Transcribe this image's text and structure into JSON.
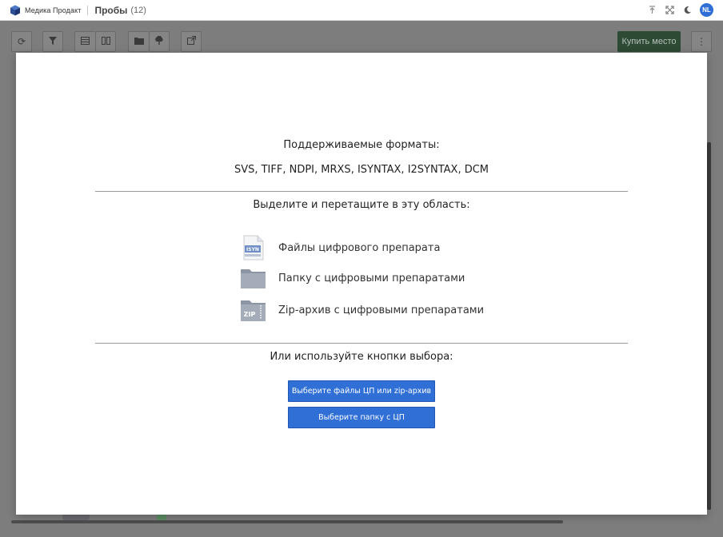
{
  "app": {
    "brand": "Медика Продакт",
    "page_title": "Пробы",
    "page_count": "(12)",
    "user_initials": "NL",
    "icons": [
      "upload-top-icon",
      "fullscreen-icon",
      "moon-icon"
    ]
  },
  "toolbar": {
    "icons": [
      "refresh-icon",
      "filter-icon",
      "table-view-icon",
      "split-view-icon",
      "folder-icon",
      "cloud-upload-icon",
      "open-external-icon"
    ],
    "buy_label": "Купить место",
    "more_icon": "more-vertical-icon"
  },
  "modal": {
    "supported_title": "Поддерживаемые форматы:",
    "formats": "SVS, TIFF, NDPI, MRXS, ISYNTAX, I2SYNTAX, DCM",
    "drag_title": "Выделите и перетащите в эту область:",
    "items": [
      {
        "icon": "isyn-file-icon",
        "icon_text": "ISYN",
        "label": "Файлы цифрового препарата"
      },
      {
        "icon": "folder-icon",
        "label": "Папку с цифровыми препаратами"
      },
      {
        "icon": "zip-folder-icon",
        "icon_text": "ZIP",
        "label": "Zip-архив с цифровыми препаратами"
      }
    ],
    "or_title": "Или используйте кнопки выбора:",
    "select_files_label": "Выберите файлы ЦП или zip-архив",
    "select_folder_label": "Выберите папку с ЦП"
  },
  "colors": {
    "accent": "#2f6fd6",
    "buy_button": "#2d4a35",
    "overlay": "#7d7d7d"
  }
}
